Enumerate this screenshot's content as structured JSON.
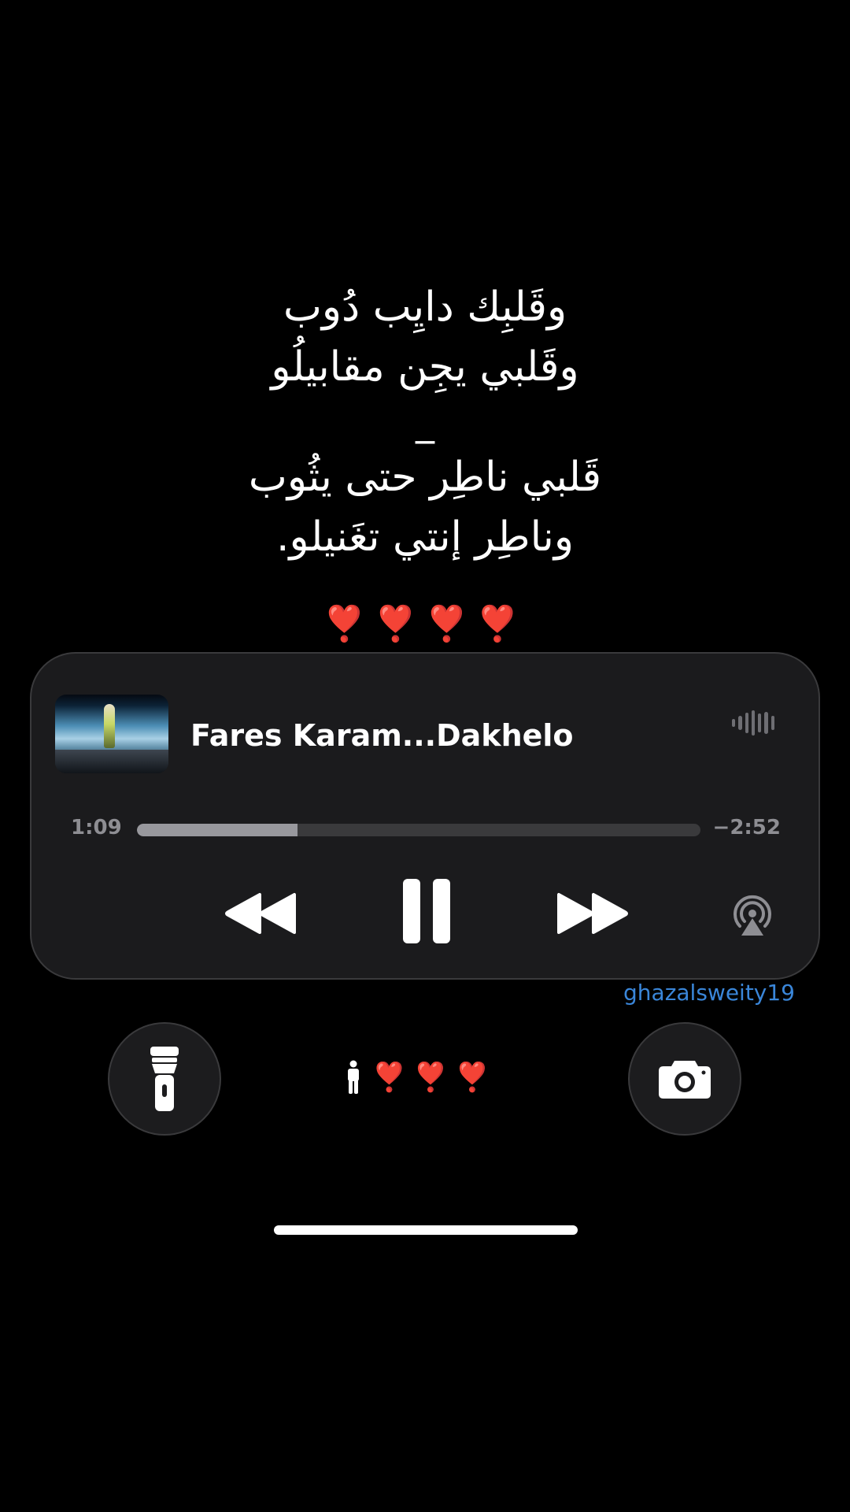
{
  "lyrics": {
    "line1": "وقَلبِك دايِب دُوب",
    "line2": "وقَلبي يجِن مقابيلُو",
    "dash": "_",
    "line3": "قَلبي ناطِر حتى يثُوب",
    "line4": "وناطِر إنتي تغَنيلو."
  },
  "hearts_top": "❣️❣️❣️❣️",
  "player": {
    "title": "Fares Karam...Dakhelo",
    "elapsed": "1:09",
    "remaining": "−2:52",
    "progress_fraction": 0.285,
    "artwork_icon": "music-video-artwork",
    "waveform_icon": "audio-waveform-icon",
    "rewind_icon": "rewind-icon",
    "pause_icon": "pause-icon",
    "forward_icon": "fast-forward-icon",
    "airplay_icon": "airplay-audio-icon"
  },
  "username": "ghazalsweity19",
  "bottom": {
    "flashlight_icon": "flashlight-icon",
    "camera_icon": "camera-icon",
    "person_icon": "person-standing-icon",
    "hearts": "❣️❣️❣️"
  },
  "colors": {
    "background": "#000000",
    "player_bg": "#1b1b1d",
    "username": "#3a86d9",
    "hearts": "#e0162b"
  }
}
